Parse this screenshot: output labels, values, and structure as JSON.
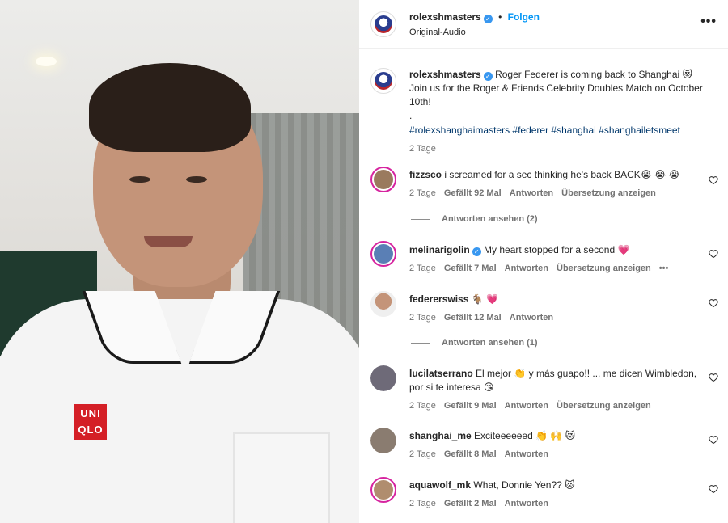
{
  "media": {
    "shirt_logo": "UNI QLO"
  },
  "header": {
    "username": "rolexshmasters",
    "verified_icon": "verified-badge-icon",
    "separator": "•",
    "follow_label": "Folgen",
    "audio": "Original-Audio",
    "more_icon": "more-options-icon"
  },
  "caption": {
    "username": "rolexshmasters",
    "text": "Roger Federer is coming back to Shanghai 😻 Join us for the Roger & Friends Celebrity Doubles Match on October 10th!",
    "dot": ".",
    "hashtags": "#rolexshanghaimasters #federer #shanghai #shanghailetsmeet",
    "time": "2 Tage"
  },
  "comments": [
    {
      "username": "fizzsco",
      "text": "i screamed for a sec thinking he's back BACK😭 😭 😭",
      "time": "2 Tage",
      "likes": "Gefällt 92 Mal",
      "reply": "Antworten",
      "translate": "Übersetzung anzeigen",
      "view_replies": "Antworten ansehen (2)"
    },
    {
      "username": "melinarigolin",
      "verified": true,
      "text": "My heart stopped for a second 💗",
      "time": "2 Tage",
      "likes": "Gefällt 7 Mal",
      "reply": "Antworten",
      "translate": "Übersetzung anzeigen",
      "more": "•••"
    },
    {
      "username": "federerswiss",
      "text": "🐐 💗",
      "time": "2 Tage",
      "likes": "Gefällt 12 Mal",
      "reply": "Antworten",
      "view_replies": "Antworten ansehen (1)"
    },
    {
      "username": "lucilatserrano",
      "text": "El mejor 👏 y más guapo!! ... me dicen Wimbledon, por si te interesa 😘",
      "time": "2 Tage",
      "likes": "Gefällt 9 Mal",
      "reply": "Antworten",
      "translate": "Übersetzung anzeigen"
    },
    {
      "username": "shanghai_me",
      "text": "Exciteeeeeed 👏 🙌 😻",
      "time": "2 Tage",
      "likes": "Gefällt 8 Mal",
      "reply": "Antworten"
    },
    {
      "username": "aquawolf_mk",
      "text": "What, Donnie Yen?? 😻",
      "time": "2 Tage",
      "likes": "Gefällt 2 Mal",
      "reply": "Antworten"
    }
  ],
  "colors": {
    "link": "#0095f6",
    "hashtag": "#00376b",
    "muted": "#737373",
    "verified": "#3897f0"
  }
}
